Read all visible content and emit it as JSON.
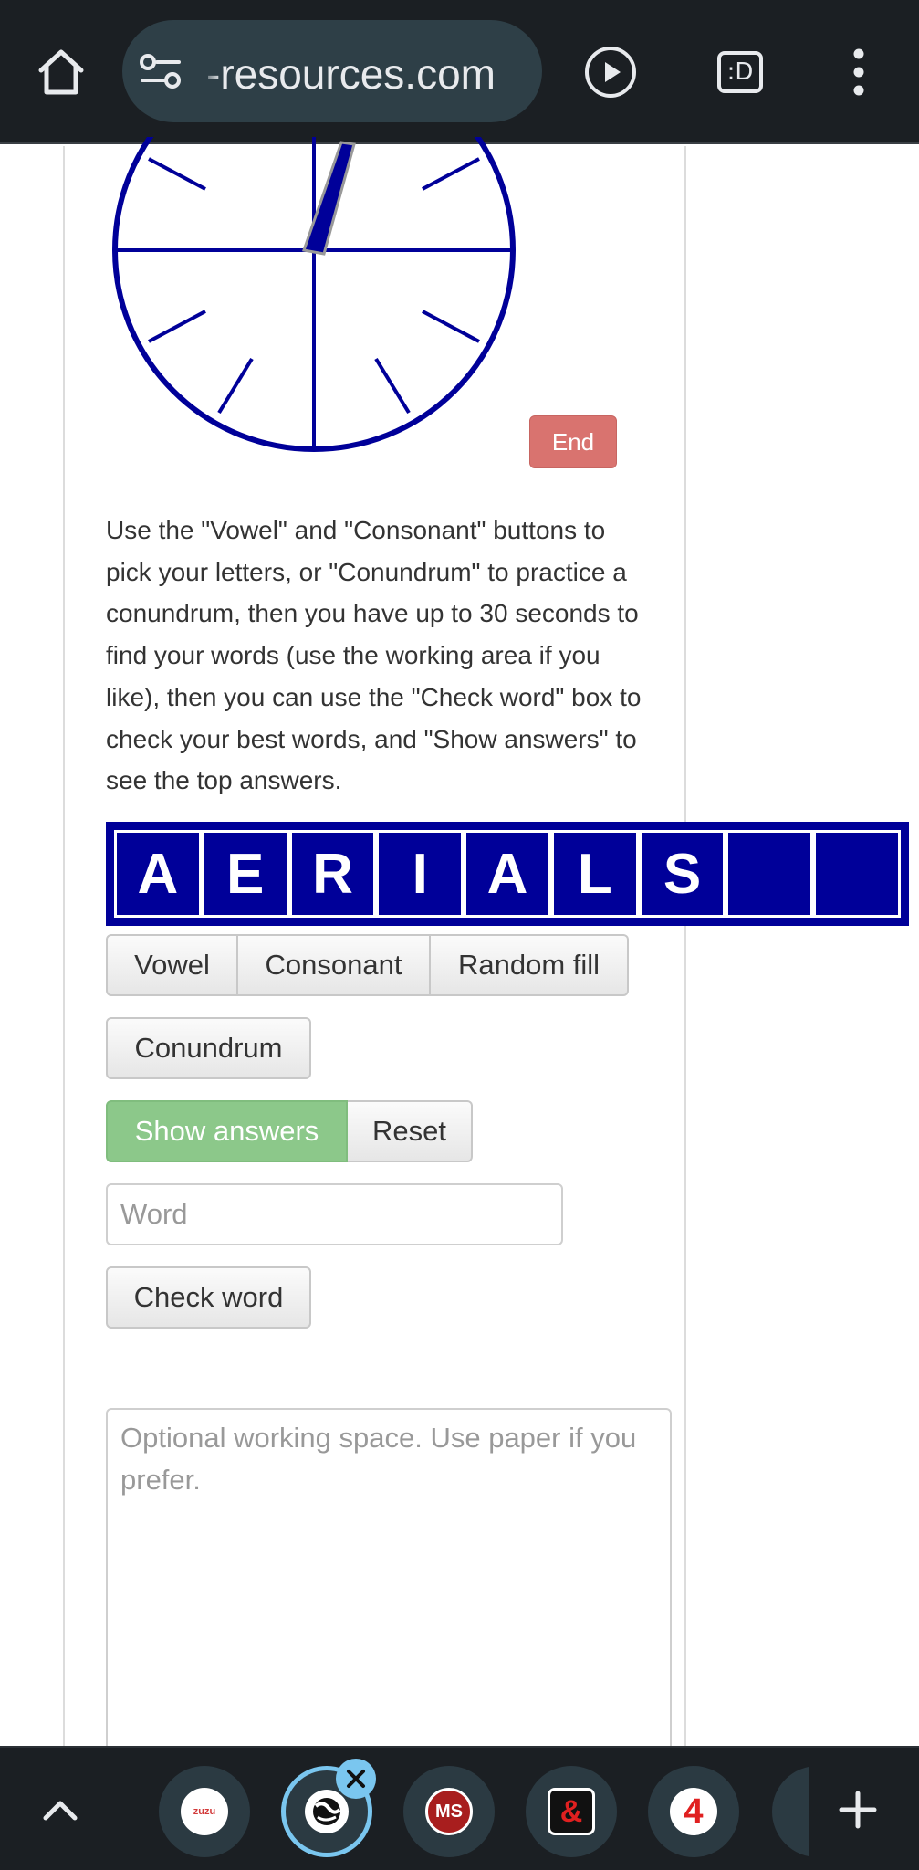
{
  "browser": {
    "url": "-resources.com",
    "d_button_label": ":D"
  },
  "game": {
    "end_label": "End",
    "instructions": "Use the \"Vowel\" and \"Consonant\" buttons to pick your letters, or \"Conundrum\" to practice a conundrum, then you have up to 30 seconds to find your words (use the working area if you like), then you can use the \"Check word\" box to check your best words, and \"Show answers\" to see the top answers.",
    "letters": [
      "A",
      "E",
      "R",
      "I",
      "A",
      "L",
      "S",
      "",
      ""
    ],
    "buttons": {
      "vowel": "Vowel",
      "consonant": "Consonant",
      "random_fill": "Random fill",
      "conundrum": "Conundrum",
      "show_answers": "Show answers",
      "reset": "Reset",
      "check_word": "Check word"
    },
    "word_placeholder": "Word",
    "working_placeholder": "Optional working space. Use paper if you prefer."
  },
  "tabs": [
    {
      "icon": "zuzu-favicon-icon",
      "label": "zuzu"
    },
    {
      "icon": "globe-favicon-icon",
      "active": true
    },
    {
      "icon": "ms-favicon-icon",
      "label": "MS"
    },
    {
      "icon": "dnd-favicon-icon",
      "label": "&"
    },
    {
      "icon": "four-favicon-icon",
      "label": "4"
    }
  ],
  "colors": {
    "tile_bg": "#000099",
    "end_button": "#d9736f",
    "show_answers_bg": "#8cc88a",
    "clock_blue": "#000099",
    "browser_chrome": "#1b1f23",
    "active_tab_ring": "#7ac6ef"
  }
}
